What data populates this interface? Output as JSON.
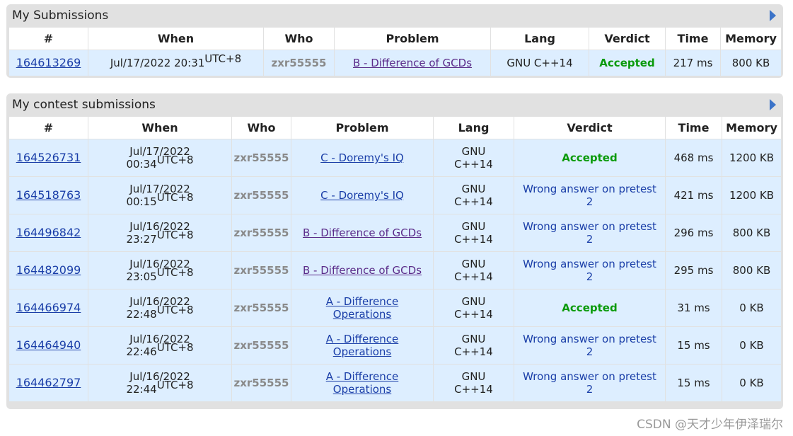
{
  "my_submissions": {
    "title": "My Submissions",
    "headers": [
      "#",
      "When",
      "Who",
      "Problem",
      "Lang",
      "Verdict",
      "Time",
      "Memory"
    ],
    "rows": [
      {
        "id": "164613269",
        "date": "Jul/17/2022 20:31",
        "tz": "UTC+8",
        "who": "zxr55555",
        "problem": "B - Difference of GCDs",
        "lang": "GNU C++14",
        "verdict": "Accepted",
        "time": "217 ms",
        "memory": "800 KB"
      }
    ]
  },
  "contest_submissions": {
    "title": "My contest submissions",
    "headers": [
      "#",
      "When",
      "Who",
      "Problem",
      "Lang",
      "Verdict",
      "Time",
      "Memory"
    ],
    "rows": [
      {
        "id": "164526731",
        "date": "Jul/17/2022",
        "clock": "00:34",
        "tz": "UTC+8",
        "who": "zxr55555",
        "problem": "C - Doremy's IQ",
        "lang_a": "GNU",
        "lang_b": "C++14",
        "verdict_a": "Accepted",
        "verdict_b": "",
        "time": "468 ms",
        "memory": "1200 KB"
      },
      {
        "id": "164518763",
        "date": "Jul/17/2022",
        "clock": "00:15",
        "tz": "UTC+8",
        "who": "zxr55555",
        "problem": "C - Doremy's IQ",
        "lang_a": "GNU",
        "lang_b": "C++14",
        "verdict_a": "Wrong answer on pretest",
        "verdict_b": "2",
        "time": "421 ms",
        "memory": "1200 KB"
      },
      {
        "id": "164496842",
        "date": "Jul/16/2022",
        "clock": "23:27",
        "tz": "UTC+8",
        "who": "zxr55555",
        "problem": "B - Difference of GCDs",
        "lang_a": "GNU",
        "lang_b": "C++14",
        "verdict_a": "Wrong answer on pretest",
        "verdict_b": "2",
        "time": "296 ms",
        "memory": "800 KB"
      },
      {
        "id": "164482099",
        "date": "Jul/16/2022",
        "clock": "23:05",
        "tz": "UTC+8",
        "who": "zxr55555",
        "problem": "B - Difference of GCDs",
        "lang_a": "GNU",
        "lang_b": "C++14",
        "verdict_a": "Wrong answer on pretest",
        "verdict_b": "2",
        "time": "295 ms",
        "memory": "800 KB"
      },
      {
        "id": "164466974",
        "date": "Jul/16/2022",
        "clock": "22:48",
        "tz": "UTC+8",
        "who": "zxr55555",
        "problem_a": "A - Difference",
        "problem_b": "Operations",
        "lang_a": "GNU",
        "lang_b": "C++14",
        "verdict_a": "Accepted",
        "verdict_b": "",
        "time": "31 ms",
        "memory": "0 KB"
      },
      {
        "id": "164464940",
        "date": "Jul/16/2022",
        "clock": "22:46",
        "tz": "UTC+8",
        "who": "zxr55555",
        "problem_a": "A - Difference",
        "problem_b": "Operations",
        "lang_a": "GNU",
        "lang_b": "C++14",
        "verdict_a": "Wrong answer on pretest",
        "verdict_b": "2",
        "time": "15 ms",
        "memory": "0 KB"
      },
      {
        "id": "164462797",
        "date": "Jul/16/2022",
        "clock": "22:44",
        "tz": "UTC+8",
        "who": "zxr55555",
        "problem_a": "A - Difference",
        "problem_b": "Operations",
        "lang_a": "GNU",
        "lang_b": "C++14",
        "verdict_a": "Wrong answer on pretest",
        "verdict_b": "2",
        "time": "15 ms",
        "memory": "0 KB"
      }
    ]
  },
  "watermark": "CSDN @天才少年伊泽瑞尔",
  "colors": {
    "accepted": "#0a9a0a",
    "wrong": "#1a3ea8",
    "row_bg": "#ddeeff",
    "frame": "#e1e1e1"
  }
}
